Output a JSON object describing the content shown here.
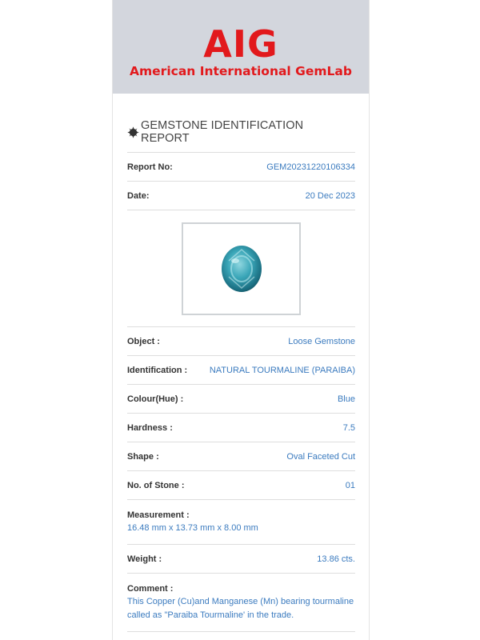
{
  "header": {
    "logo": "AIG",
    "lab_name": "American International GemLab"
  },
  "report": {
    "title": "GEMSTONE IDENTIFICATION REPORT",
    "title_icon": "gear-badge-icon",
    "report_no_label": "Report No:",
    "report_no": "GEM20231220106334",
    "date_label": "Date:",
    "date": "20 Dec 2023"
  },
  "details": {
    "object_label": "Object :",
    "object": "Loose Gemstone",
    "identification_label": "Identification :",
    "identification": "NATURAL TOURMALINE (PARAIBA)",
    "colour_label": "Colour(Hue) :",
    "colour": "Blue",
    "hardness_label": "Hardness :",
    "hardness": "7.5",
    "shape_label": "Shape :",
    "shape": "Oval Faceted Cut",
    "stones_label": "No. of Stone :",
    "stones": "01",
    "measurement_label": "Measurement :",
    "measurement": "16.48 mm x 13.73 mm x 8.00 mm",
    "weight_label": "Weight :",
    "weight": "13.86 cts.",
    "comment_label": "Comment :",
    "comment": "This Copper (Cu)and Manganese (Mn) bearing tourmaline called as \"Paraiba Tourmaline' in the trade."
  },
  "colors": {
    "brand_red": "#e2191c",
    "value_blue": "#3b7bbf",
    "banner_bg": "#d3d6dd",
    "gem_teal": "#3aa6b8"
  }
}
